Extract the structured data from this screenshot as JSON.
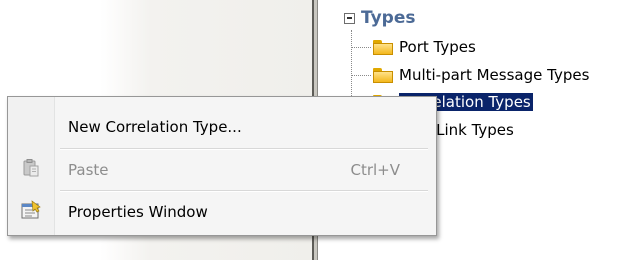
{
  "tree": {
    "root": {
      "label": "Types",
      "icon": "collapse-icon"
    },
    "items": [
      {
        "label": "Port Types",
        "icon": "folder-icon",
        "selected": false
      },
      {
        "label": "Multi-part Message Types",
        "icon": "folder-icon",
        "selected": false
      },
      {
        "label": "Correlation Types",
        "icon": "folder-icon",
        "selected": true
      },
      {
        "label": "Role Link Types",
        "icon": "folder-icon",
        "selected": false
      }
    ]
  },
  "context_menu": {
    "items": [
      {
        "label": "New Correlation Type...",
        "shortcut": "",
        "icon": "",
        "disabled": false
      },
      {
        "label": "Paste",
        "shortcut": "Ctrl+V",
        "icon": "paste-icon",
        "disabled": true
      },
      {
        "label": "Properties Window",
        "shortcut": "",
        "icon": "properties-window-icon",
        "disabled": false
      }
    ]
  },
  "colors": {
    "selection_bg": "#0a246a",
    "selection_fg": "#ffffff",
    "root_label": "#4c6a96",
    "disabled_text": "#8d8d8d"
  }
}
